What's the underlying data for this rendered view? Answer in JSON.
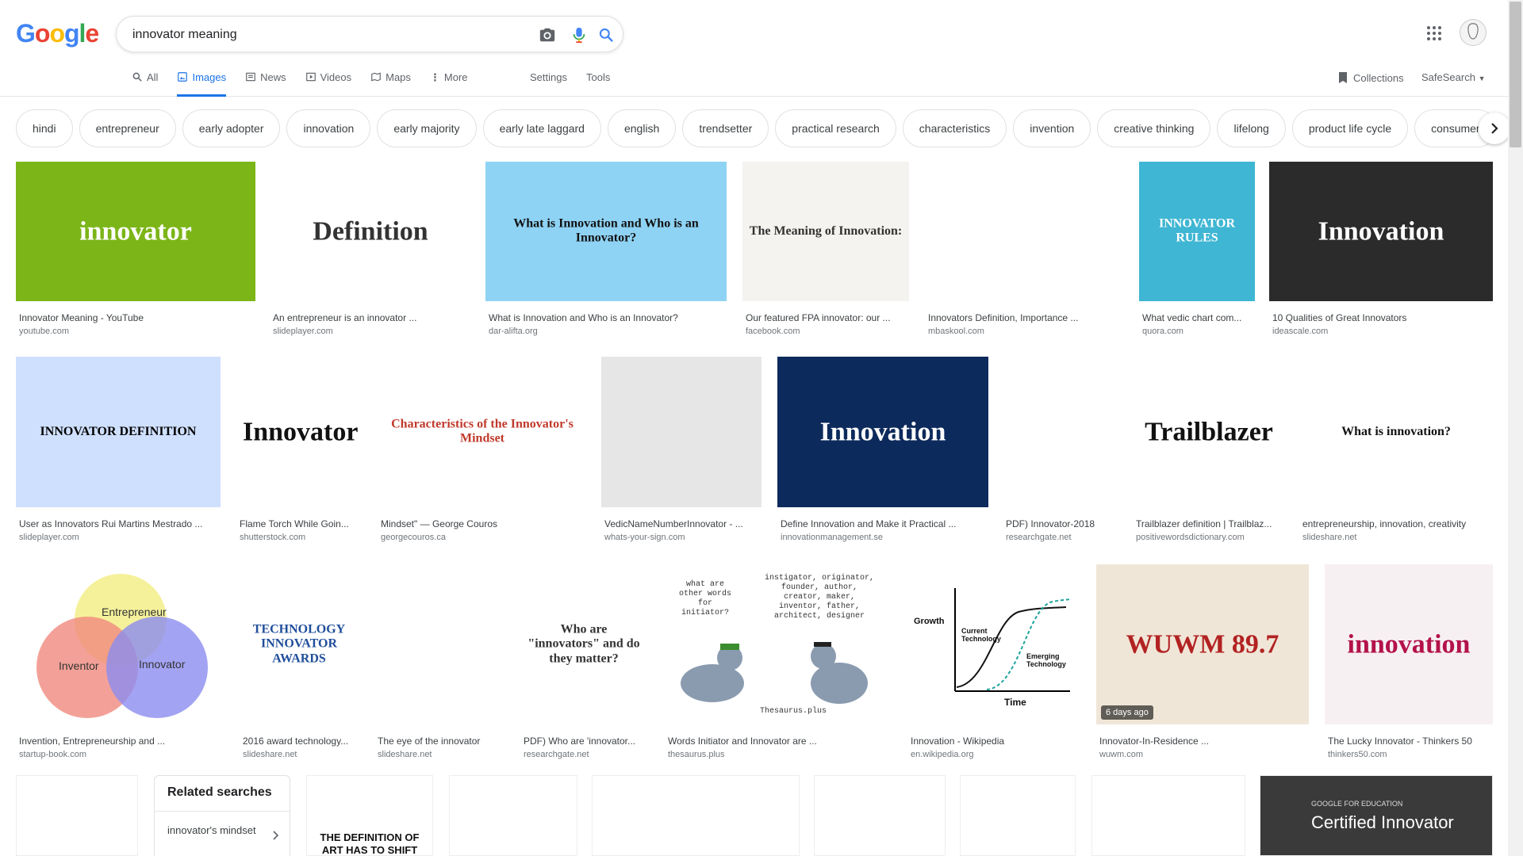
{
  "search": {
    "query": "innovator meaning"
  },
  "logo": {
    "letters": [
      "G",
      "o",
      "o",
      "g",
      "l",
      "e"
    ]
  },
  "tabs": [
    {
      "label": "All",
      "icon": "search-icon"
    },
    {
      "label": "Images",
      "icon": "image-icon",
      "active": true
    },
    {
      "label": "News",
      "icon": "news-icon"
    },
    {
      "label": "Videos",
      "icon": "video-icon"
    },
    {
      "label": "Maps",
      "icon": "map-icon"
    },
    {
      "label": "More",
      "icon": "more-vert-icon"
    }
  ],
  "tools": {
    "settings": "Settings",
    "tools": "Tools",
    "collections": "Collections",
    "safesearch": "SafeSearch"
  },
  "chips": [
    "hindi",
    "entrepreneur",
    "early adopter",
    "innovation",
    "early majority",
    "early late laggard",
    "english",
    "trendsetter",
    "practical research",
    "characteristics",
    "invention",
    "creative thinking",
    "lifelong",
    "product life cycle",
    "consumer"
  ],
  "results": [
    {
      "caption": "Innovator Meaning - YouTube",
      "source": "youtube.com",
      "thumb_text": "innovator",
      "bg": "#7cb518",
      "fg": "#ffffff"
    },
    {
      "caption": "An entrepreneur is an innovator ...",
      "source": "slideplayer.com",
      "thumb_text": "Definition",
      "bg": "#ffffff",
      "fg": "#333333"
    },
    {
      "caption": "What is Innovation and Who is an Innovator?",
      "source": "dar-alifta.org",
      "thumb_text": "What is Innovation and Who is an Innovator?",
      "bg": "#8fd3f4",
      "fg": "#111111"
    },
    {
      "caption": "Our featured FPA innovator: our ...",
      "source": "facebook.com",
      "thumb_text": "The Meaning of Innovation:",
      "bg": "#f5f3ef",
      "fg": "#333333"
    },
    {
      "caption": "Innovators Definition, Importance ...",
      "source": "mbaskool.com",
      "thumb_text": "",
      "bg": "#ffffff",
      "fg": "#333333"
    },
    {
      "caption": "What vedic chart com...",
      "source": "quora.com",
      "thumb_text": "INNOVATOR RULES",
      "bg": "#3fb6d3",
      "fg": "#ffffff"
    },
    {
      "caption": "10 Qualities of Great Innovators",
      "source": "ideascale.com",
      "thumb_text": "Innovation",
      "bg": "#2b2b2b",
      "fg": "#ffffff"
    },
    {
      "caption": "User as Innovators Rui Martins Mestrado ...",
      "source": "slideplayer.com",
      "thumb_text": "INNOVATOR DEFINITION",
      "bg": "#cfe0ff",
      "fg": "#000000"
    },
    {
      "caption": "Flame Torch While Goin...",
      "source": "shutterstock.com",
      "thumb_text": "Innovator",
      "bg": "#ffffff",
      "fg": "#111111"
    },
    {
      "caption": "Mindset\" — George Couros",
      "source": "georgecouros.ca",
      "thumb_text": "Characteristics of the Innovator's Mindset",
      "bg": "#ffffff",
      "fg": "#c0392b"
    },
    {
      "caption": "VedicNameNumberInnovator - ...",
      "source": "whats-your-sign.com",
      "thumb_text": "",
      "bg": "#e6e6e6",
      "fg": "#333333"
    },
    {
      "caption": "Define Innovation and Make it Practical ...",
      "source": "innovationmanagement.se",
      "thumb_text": "Innovation",
      "bg": "#0d2a5c",
      "fg": "#ffffff"
    },
    {
      "caption": "PDF) Innovator-2018",
      "source": "researchgate.net",
      "thumb_text": "",
      "bg": "#ffffff",
      "fg": "#555555"
    },
    {
      "caption": "Trailblazer definition | Trailblaz...",
      "source": "positivewordsdictionary.com",
      "thumb_text": "Trailblazer",
      "bg": "#ffffff",
      "fg": "#111111"
    },
    {
      "caption": "entrepreneurship, innovation, creativity",
      "source": "slideshare.net",
      "thumb_text": "What is innovation?",
      "bg": "#ffffff",
      "fg": "#111111"
    },
    {
      "caption": "Invention, Entrepreneurship and ...",
      "source": "startup-book.com",
      "thumb_text": "",
      "bg": "#ffffff",
      "fg": "#333333"
    },
    {
      "caption": "2016 award technology...",
      "source": "slideshare.net",
      "thumb_text": "TECHNOLOGY INNOVATOR AWARDS",
      "bg": "#ffffff",
      "fg": "#1f4e9a"
    },
    {
      "caption": "The eye of the innovator",
      "source": "slideshare.net",
      "thumb_text": "",
      "bg": "#ffffff",
      "fg": "#555555"
    },
    {
      "caption": "PDF) Who are 'innovator...",
      "source": "researchgate.net",
      "thumb_text": "Who are \"innovators\" and do they matter?",
      "bg": "#ffffff",
      "fg": "#333333"
    },
    {
      "caption": "Words Initiator and Innovator are ...",
      "source": "thesaurus.plus",
      "thumb_text": "",
      "bg": "#ffffff",
      "fg": "#333333"
    },
    {
      "caption": "Innovation - Wikipedia",
      "source": "en.wikipedia.org",
      "thumb_text": "",
      "bg": "#ffffff",
      "fg": "#111111"
    },
    {
      "caption": "Innovator-In-Residence ...",
      "source": "wuwm.com",
      "thumb_text": "WUWM 89.7",
      "bg": "#f0e6d8",
      "fg": "#b22222",
      "badge": "6 days ago"
    },
    {
      "caption": "The Lucky Innovator - Thinkers 50",
      "source": "thinkers50.com",
      "thumb_text": "innovation",
      "bg": "#f7f0f3",
      "fg": "#b3124a"
    }
  ],
  "venn": {
    "top": "Entrepreneur",
    "left": "Inventor",
    "right": "Innovator"
  },
  "wiki_chart": {
    "ylabel": "Growth",
    "xlabel": "Time",
    "current": "Current Technology",
    "emerging": "Emerging Technology"
  },
  "thesaurus": {
    "left_q": "what are other words for initiator?",
    "right_words": "instigator, originator, founder, author, creator, maker, inventor, father, architect, designer",
    "brand": "Thesaurus.plus"
  },
  "bottom_row": [
    {
      "thumb_text": "",
      "bg": "#ffffff"
    },
    {
      "thumb_text": "THE DEFINITION OF ART HAS TO SHIFT WHENEVER",
      "bg": "#ffffff"
    },
    {
      "thumb_text": "",
      "bg": "#ffffff"
    },
    {
      "thumb_text": "",
      "bg": "#ffffff"
    },
    {
      "thumb_text": "",
      "bg": "#ffffff"
    },
    {
      "thumb_text": "",
      "bg": "#ffffff"
    },
    {
      "thumb_text": "",
      "bg": "#ffffff"
    },
    {
      "thumb_text": "Certified Innovator",
      "bg": "#3a3a3a",
      "label_top": "GOOGLE FOR EDUCATION"
    }
  ],
  "related": {
    "title": "Related searches",
    "item": "innovator's mindset"
  },
  "colors": {
    "accent": "#1a73e8"
  }
}
